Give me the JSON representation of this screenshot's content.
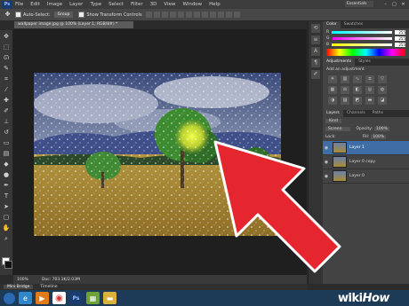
{
  "menubar": {
    "logo": "Ps",
    "items": [
      "File",
      "Edit",
      "Image",
      "Layer",
      "Type",
      "Select",
      "Filter",
      "3D",
      "View",
      "Window",
      "Help"
    ],
    "workspace": "Essentials",
    "window_buttons": [
      "–",
      "□",
      "✕"
    ]
  },
  "options": {
    "auto_select_label": "Auto-Select:",
    "auto_select_value": "Group",
    "transform_label": "Show Transform Controls"
  },
  "document": {
    "tab_title": "wallpaper image.jpg @ 100% (Layer 1, RGB/8#) *",
    "zoom": "100%",
    "doc_info": "Doc: 703.1K/2.03M"
  },
  "bottom_tabs": [
    "Mini Bridge",
    "Timeline"
  ],
  "panels": {
    "color_tabs": [
      "Color",
      "Swatches"
    ],
    "color_rows": [
      {
        "label": "R",
        "value": "255"
      },
      {
        "label": "G",
        "value": "255"
      },
      {
        "label": "B",
        "value": "255"
      }
    ],
    "adjustment_tabs": [
      "Adjustments",
      "Styles"
    ],
    "add_adjustment": "Add an adjustment",
    "layer_tabs": [
      "Layers",
      "Channels",
      "Paths"
    ],
    "kind_label": "Kind",
    "blend_mode": "Screen",
    "opacity_label": "Opacity:",
    "opacity_value": "100%",
    "lock_label": "Lock:",
    "fill_label": "Fill:",
    "fill_value": "100%",
    "layers": [
      {
        "name": "Layer 1",
        "selected": true
      },
      {
        "name": "Layer 0 copy",
        "selected": false
      },
      {
        "name": "Layer 0",
        "selected": false
      }
    ]
  },
  "taskbar": {
    "buttons": [
      "start",
      "explorer",
      "media",
      "chrome",
      "photoshop",
      "files",
      "folder"
    ]
  },
  "watermark": {
    "wiki": "wiki",
    "how": "How"
  },
  "colors": {
    "arrow": "#e5262e",
    "selected_layer": "#3f6ea7",
    "taskbar": "#1d3b57"
  }
}
